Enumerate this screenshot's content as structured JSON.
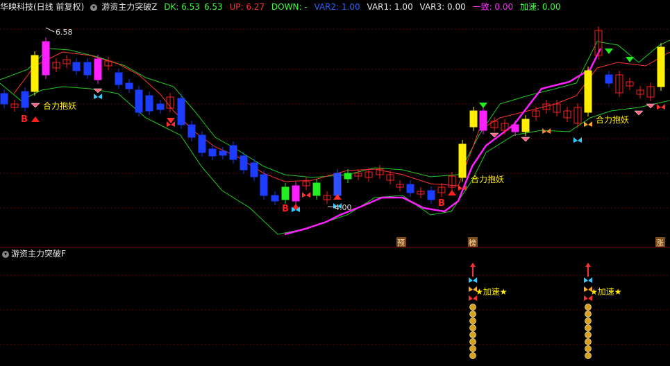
{
  "header": {
    "stock": "华映科技(日线 前复权)",
    "indicator_name": "游资主力突破Z",
    "dk_label": "DK: 6.53",
    "dk_value2": "6.53",
    "up": "UP: 6.27",
    "down": "DOWN: -",
    "var2": "VAR2: 1.00",
    "var1": "VAR1: 1.00",
    "var3": "VAR3: 0.00",
    "yizhi": "一致: 0.00",
    "jiasu": "加速: 0.00"
  },
  "main": {
    "high_label": "6.58",
    "signal_text": "合力抱妖",
    "b_label": "B",
    "low_label": "4.00",
    "tags": [
      "预",
      "榜",
      "涨"
    ]
  },
  "sub": {
    "title": "游资主力突破F",
    "accel_text": "★加速★"
  },
  "colors": {
    "up_candle": "#ff2020",
    "down_candle": "#1c3cff",
    "upper_band": "#22cc22",
    "mid_line": "#ff3333",
    "low_line": "#ff20ff",
    "yellow": "#ffee00",
    "grid": "#6a0000"
  }
}
